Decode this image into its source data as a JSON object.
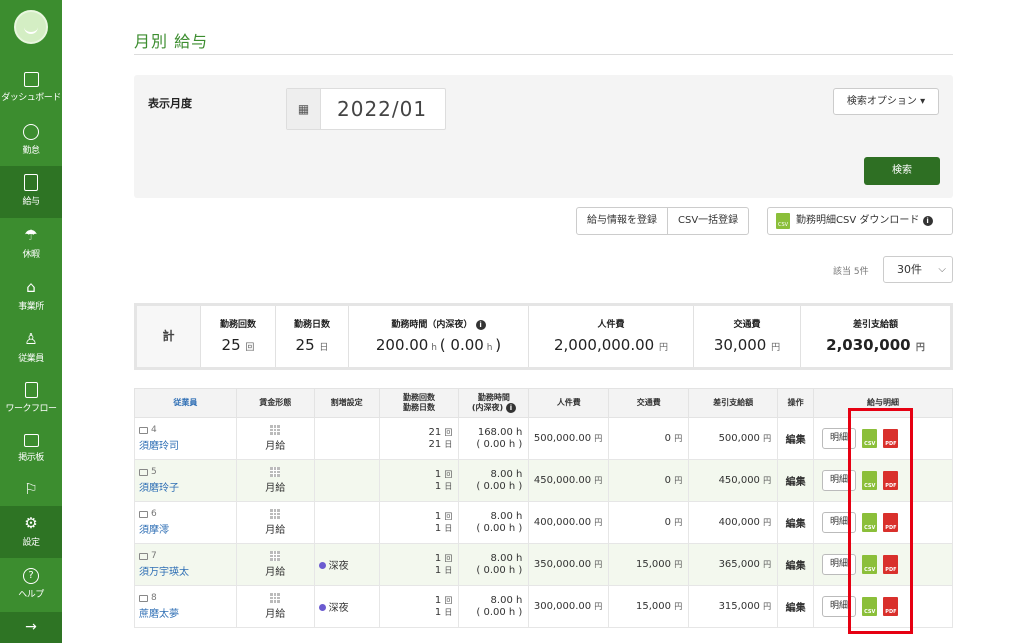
{
  "sidebar": {
    "items": [
      {
        "label": "ダッシュボード",
        "icon": "grid-icon"
      },
      {
        "label": "勤怠",
        "icon": "clock-icon"
      },
      {
        "label": "給与",
        "icon": "calculator-icon"
      },
      {
        "label": "休暇",
        "icon": "umbrella-icon"
      },
      {
        "label": "事業所",
        "icon": "home-icon"
      },
      {
        "label": "従業員",
        "icon": "person-icon"
      },
      {
        "label": "ワークフロー",
        "icon": "document-check-icon"
      },
      {
        "label": "掲示板",
        "icon": "chat-icon"
      },
      {
        "label": "",
        "icon": "flag-icon"
      },
      {
        "label": "設定",
        "icon": "gear-icon"
      },
      {
        "label": "ヘルプ",
        "icon": "help-icon"
      }
    ],
    "collapse_glyph": "→",
    "accent": "#3c8d2f"
  },
  "page": {
    "title": "月別 給与"
  },
  "search": {
    "month_label": "表示月度",
    "month_value": "2022/01",
    "options_label": "検索オプション ▾",
    "search_label": "検索"
  },
  "actions": {
    "register": "給与情報を登録",
    "csv_bulk": "CSV一括登録",
    "csv_download": "勤務明細CSV ダウンロード"
  },
  "paging": {
    "hit_count": "該当 5件",
    "per_page": "30件"
  },
  "totals": {
    "label": "計",
    "work_count_h": "勤務回数",
    "work_count_v": "25",
    "work_count_u": "回",
    "work_days_h": "勤務日数",
    "work_days_v": "25",
    "work_days_u": "日",
    "hours_h": "勤務時間（内深夜）",
    "hours_v": "200.00",
    "hours_night": "0.00",
    "labor_h": "人件費",
    "labor_v": "2,000,000.00",
    "labor_u": "円",
    "transport_h": "交通費",
    "transport_v": "30,000",
    "transport_u": "円",
    "net_h": "差引支給額",
    "net_v": "2,030,000",
    "net_u": "円"
  },
  "table": {
    "headers": {
      "employee": "従業員",
      "pay_type": "賃金形態",
      "premium": "割増設定",
      "count_days_1": "勤務回数",
      "count_days_2": "勤務日数",
      "hours_1": "勤務時間",
      "hours_2": "(内深夜)",
      "labor": "人件費",
      "transport": "交通費",
      "net": "差引支給額",
      "ops": "操作",
      "payslip": "給与明細"
    },
    "rows": [
      {
        "no": "4",
        "name": "須磨玲司",
        "pay": "月給",
        "premium": "",
        "count": "21",
        "days": "21",
        "hours": "168.00 h",
        "night": "( 0.00 h )",
        "labor": "500,000.00",
        "transport": "0",
        "net": "500,000",
        "edit": "編集",
        "detail": "明細"
      },
      {
        "no": "5",
        "name": "須磨玲子",
        "pay": "月給",
        "premium": "",
        "count": "1",
        "days": "1",
        "hours": "8.00 h",
        "night": "( 0.00 h )",
        "labor": "450,000.00",
        "transport": "0",
        "net": "450,000",
        "edit": "編集",
        "detail": "明細"
      },
      {
        "no": "6",
        "name": "須摩澪",
        "pay": "月給",
        "premium": "",
        "count": "1",
        "days": "1",
        "hours": "8.00 h",
        "night": "( 0.00 h )",
        "labor": "400,000.00",
        "transport": "0",
        "net": "400,000",
        "edit": "編集",
        "detail": "明細"
      },
      {
        "no": "7",
        "name": "須万宇瑛太",
        "pay": "月給",
        "premium": "深夜",
        "count": "1",
        "days": "1",
        "hours": "8.00 h",
        "night": "( 0.00 h )",
        "labor": "350,000.00",
        "transport": "15,000",
        "net": "365,000",
        "edit": "編集",
        "detail": "明細"
      },
      {
        "no": "8",
        "name": "蔗磨太夢",
        "pay": "月給",
        "premium": "深夜",
        "count": "1",
        "days": "1",
        "hours": "8.00 h",
        "night": "( 0.00 h )",
        "labor": "300,000.00",
        "transport": "15,000",
        "net": "315,000",
        "edit": "編集",
        "detail": "明細"
      }
    ],
    "units": {
      "count": "回",
      "days": "日",
      "yen": "円",
      "csv": "CSV",
      "pdf": "PDF"
    }
  },
  "colors": {
    "highlight": "#e60012",
    "link": "#2f6fb5",
    "button_dark": "#2e6f23"
  }
}
